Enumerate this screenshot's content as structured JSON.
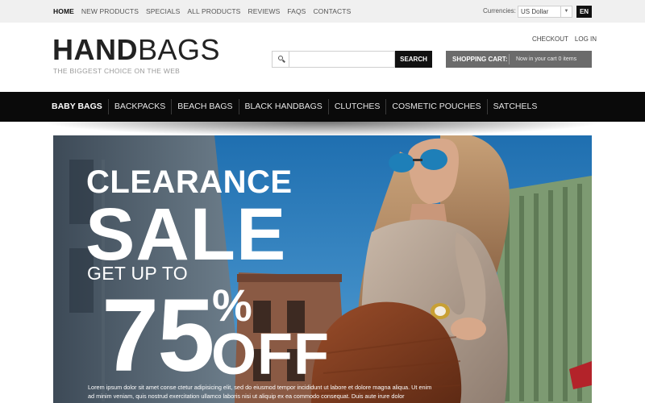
{
  "topbar": {
    "nav": [
      "Home",
      "New Products",
      "Specials",
      "All Products",
      "Reviews",
      "FAQs",
      "Contacts"
    ],
    "currency_label": "Currencies:",
    "currency_value": "US Dollar",
    "language": "EN"
  },
  "header": {
    "logo_bold": "HAND",
    "logo_light": "BAGS",
    "tagline": "The biggest choice on the web",
    "links": [
      "Checkout",
      "Log In"
    ],
    "search": {
      "placeholder": "",
      "button": "Search"
    },
    "cart": {
      "label": "Shopping Cart:",
      "status": "Now in your cart 0 items"
    }
  },
  "mainnav": {
    "items": [
      "Baby Bags",
      "Backpacks",
      "Beach Bags",
      "Black Handbags",
      "Clutches",
      "Cosmetic Pouches",
      "Satchels"
    ]
  },
  "hero": {
    "line1": "CLEARANCE",
    "line2": "SALE",
    "line3": "GET UP TO",
    "number": "75",
    "percent": "%",
    "off": "OFF",
    "caption": "Lorem ipsum dolor sit amet conse ctetur adipisicing elit, sed do eiusmod tempor incididunt ut labore et dolore magna aliqua. Ut enim ad minim veniam, quis nostrud exercitation ullamco laboris nisi ut aliquip ex ea commodo consequat. Duis aute irure dolor"
  },
  "colors": {
    "topbar_bg": "#f0f0f0",
    "nav_bg": "#0a0a0a",
    "cart_bg": "#6b6b6b",
    "search_button_bg": "#111111"
  }
}
